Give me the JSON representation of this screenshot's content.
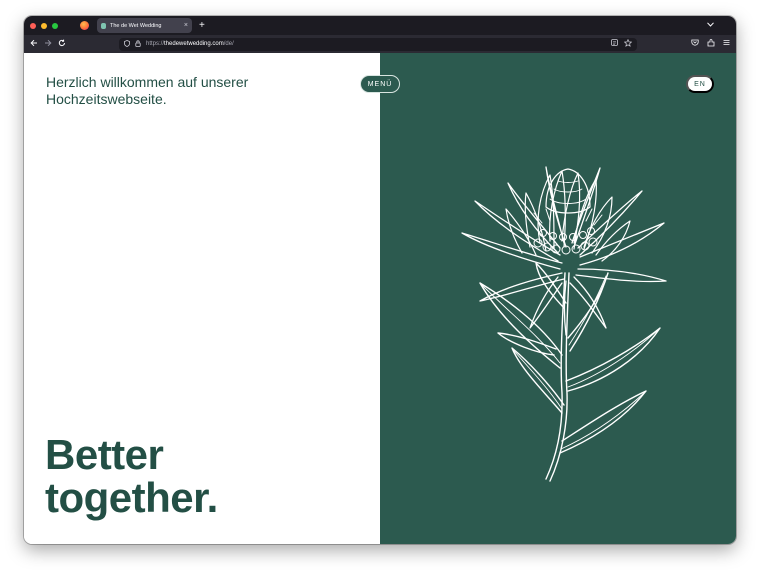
{
  "browser": {
    "tab_title": "The de Wet Wedding",
    "tab_close": "×",
    "new_tab": "+",
    "url_scheme": "https://",
    "url_domain": "thedewetwedding.com",
    "url_path": "/de/"
  },
  "page": {
    "welcome_text": "Herzlich willkommen auf unserer Hochzeitswebseite.",
    "headline_line1": "Better",
    "headline_line2": "together.",
    "menu_label": "MENÜ",
    "lang_label": "EN"
  },
  "colors": {
    "brand_green": "#2c5a4f",
    "text_green": "#234f45",
    "line_white": "#ffffff"
  },
  "icons": {
    "back": "back-arrow-icon",
    "forward": "forward-arrow-icon",
    "reload": "reload-icon",
    "shield": "tracking-shield-icon",
    "lock": "lock-icon",
    "reader": "reader-view-icon",
    "bookmark": "bookmark-star-icon",
    "pocket": "pocket-icon",
    "extensions": "extensions-icon",
    "menu": "hamburger-menu-icon",
    "illustration": "protea-flower-illustration"
  }
}
